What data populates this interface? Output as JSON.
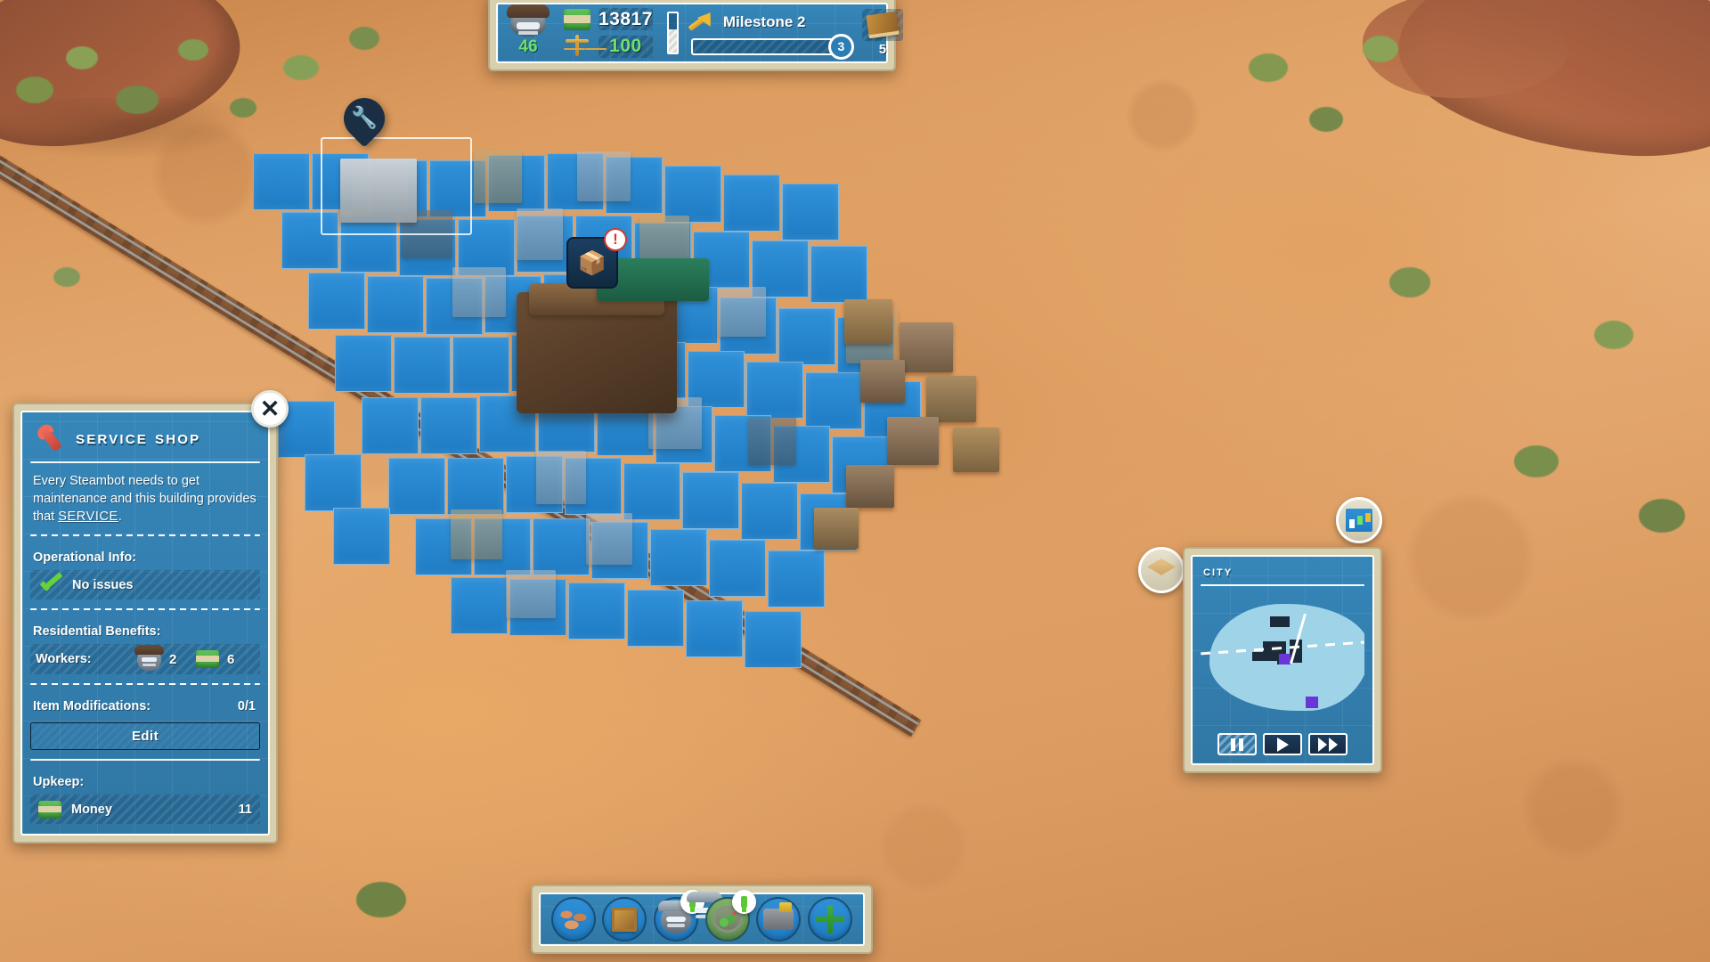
{
  "topbar": {
    "population": {
      "icon": "steambot-icon",
      "value": "46"
    },
    "cash": {
      "icon": "money-icon",
      "value": "13817"
    },
    "balance": {
      "icon": "scale-icon",
      "value": "100"
    },
    "milestone": {
      "icon": "trend-up-icon",
      "label": "Milestone 2",
      "progress_value": "3",
      "progress_percent": 0
    },
    "research": {
      "icon": "book-icon",
      "value": "5"
    }
  },
  "info_panel": {
    "icon": "wrench-icon",
    "title": "Service Shop",
    "close_label": "✕",
    "description_before": "Every Steambot needs to get maintenance and this building provides that ",
    "description_link": "SERVICE",
    "description_after": ".",
    "operational_info_label": "Operational Info:",
    "operational_status": "No issues",
    "operational_status_icon": "green-check-icon",
    "residential_benefits_label": "Residential Benefits:",
    "workers_label": "Workers:",
    "workers_count": "2",
    "workers_icon": "steambot-icon",
    "workers_money": "6",
    "workers_money_icon": "money-icon",
    "item_mods_label": "Item Modifications:",
    "item_mods_value": "0/1",
    "edit_label": "Edit",
    "upkeep_label": "Upkeep:",
    "upkeep_name": "Money",
    "upkeep_icon": "money-icon",
    "upkeep_value": "11"
  },
  "toolbar": {
    "items": [
      {
        "name": "terrain-tool",
        "icon": "terrain-icon",
        "badge": null
      },
      {
        "name": "storage-tool",
        "icon": "crate-icon",
        "badge": null
      },
      {
        "name": "steambot-tool",
        "icon": "steambot-icon",
        "badge": "!"
      },
      {
        "name": "nature-tool",
        "icon": "cactus-icon",
        "badge": "!"
      },
      {
        "name": "vehicle-tool",
        "icon": "vehicle-icon",
        "badge": null
      },
      {
        "name": "move-tool",
        "icon": "move-cross-icon",
        "badge": null
      }
    ]
  },
  "minimap": {
    "title": "City",
    "controls": [
      {
        "name": "pause-button",
        "icon": "pause-icon",
        "active": true
      },
      {
        "name": "play-button",
        "icon": "play-icon",
        "active": false
      },
      {
        "name": "fast-forward-button",
        "icon": "fast-forward-icon",
        "active": false
      }
    ]
  },
  "side_buttons": {
    "delivery": {
      "icon": "delivery-icon"
    },
    "statistics": {
      "icon": "chart-icon"
    }
  },
  "map_markers": {
    "service_pin_icon": "wrench-pin-icon",
    "warehouse_alert_icon": "crate-alert-icon",
    "warehouse_alert_badge": "!"
  }
}
